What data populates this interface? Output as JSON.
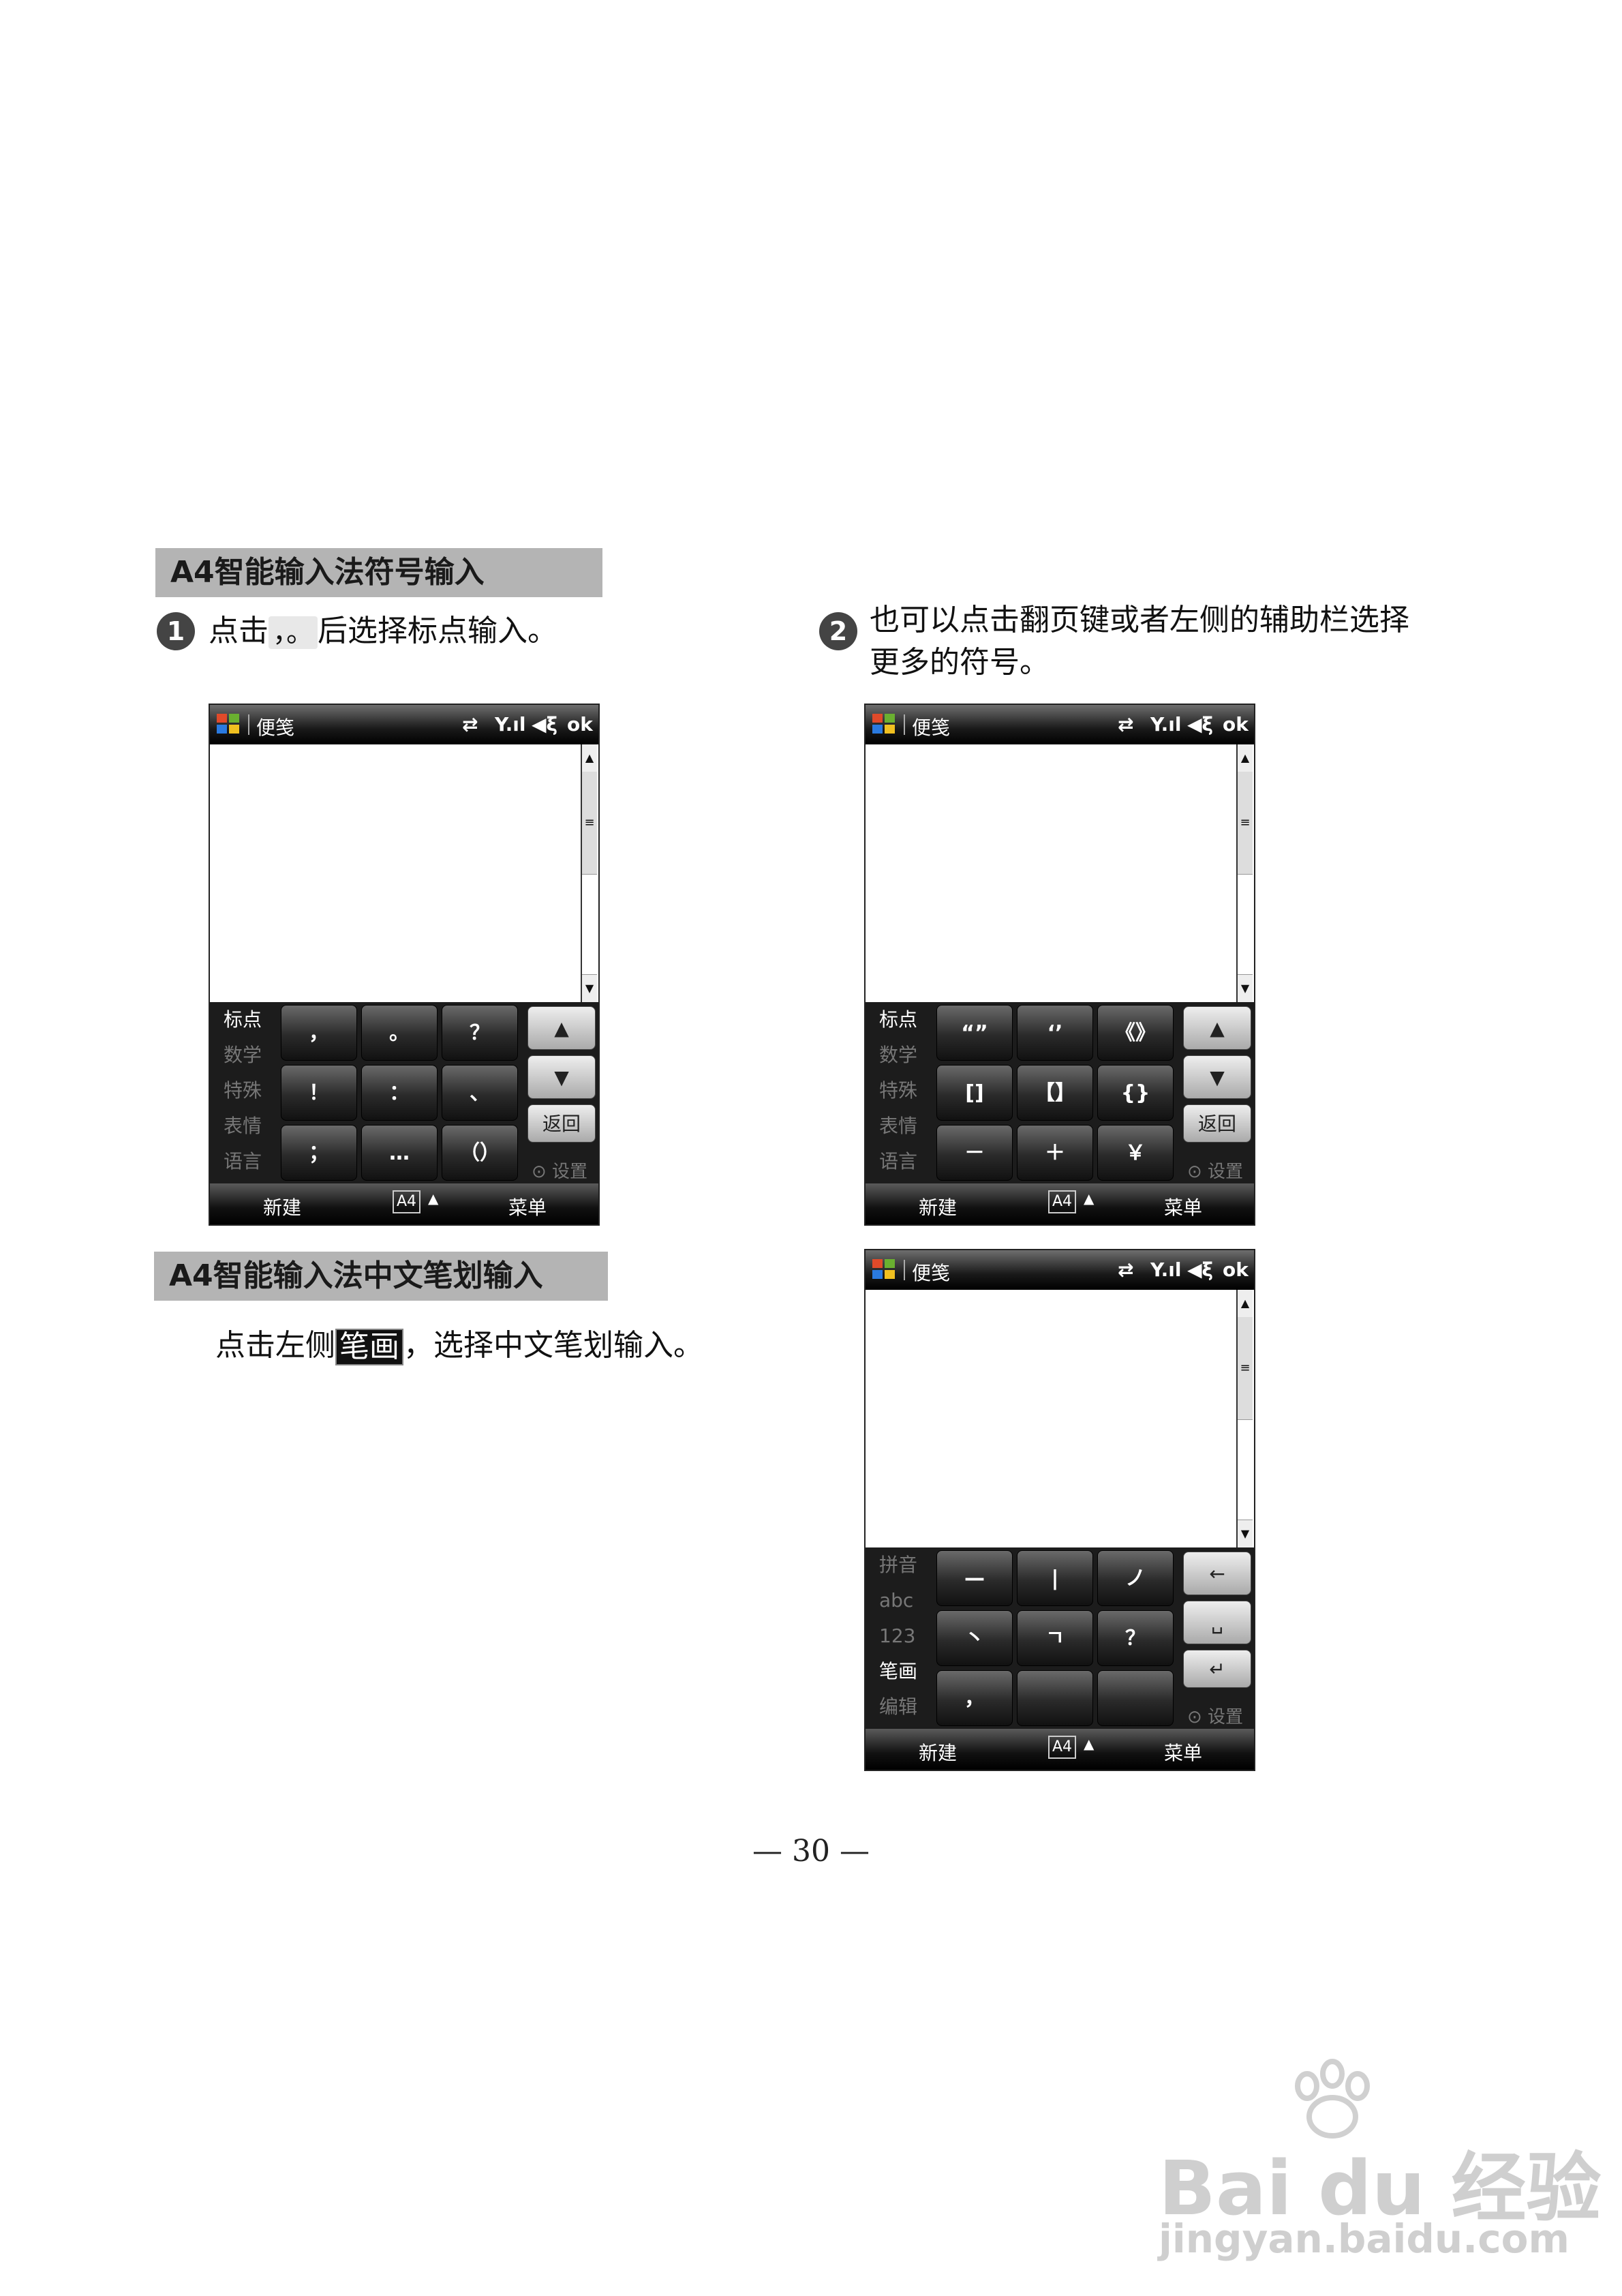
{
  "sections": [
    {
      "title": "A4智能输入法符号输入"
    },
    {
      "title": "A4智能输入法中文笔划输入"
    }
  ],
  "steps": {
    "step1": {
      "num": "1",
      "pre": "点击",
      "key": "，。",
      "post": "后选择标点输入。"
    },
    "step2": {
      "num": "2",
      "line1": "也可以点击翻页键或者左侧的辅助栏选择",
      "line2": "更多的符号。"
    },
    "stroke": {
      "pre": "点击左侧",
      "key": "笔画",
      "post": "，选择中文笔划输入。"
    }
  },
  "phone_common": {
    "app_title": "便笺",
    "ok": "ok",
    "status_sync": "⇄",
    "status_signal": "Y.ıl",
    "status_sound": "◀ξ",
    "softkey_left": "新建",
    "softkey_mid": "A4",
    "softkey_mid_arrow": "▲",
    "softkey_right": "菜单",
    "setting": "⊙ 设置",
    "return": "返回",
    "scroll_up": "▲",
    "scroll_thumb": "≡",
    "scroll_down": "▼"
  },
  "phone1": {
    "side": [
      "标点",
      "数学",
      "特殊",
      "表情",
      "语言"
    ],
    "keys": [
      "，",
      "。",
      "？",
      "！",
      "：",
      "、",
      "；",
      "…",
      "（）"
    ],
    "up": "▲",
    "down": "▼"
  },
  "phone2": {
    "side": [
      "标点",
      "数学",
      "特殊",
      "表情",
      "语言"
    ],
    "keys": [
      "“”",
      "‘’",
      "《》",
      "[]",
      "【】",
      "{}",
      "－",
      "＋",
      "￥"
    ],
    "up": "▲",
    "down": "▼"
  },
  "phone3": {
    "side": [
      "拼音",
      "abc",
      "123",
      "笔画",
      "编辑"
    ],
    "keys": [
      "—",
      "|",
      "ノ",
      "丶",
      "ㄱ",
      "？",
      "，",
      "",
      ""
    ],
    "fkeys": [
      "←",
      "␣",
      "↵"
    ]
  },
  "page_number": "— 30 —",
  "watermark": {
    "brand": "Bai du 经验",
    "url": "jingyan.baidu.com"
  }
}
